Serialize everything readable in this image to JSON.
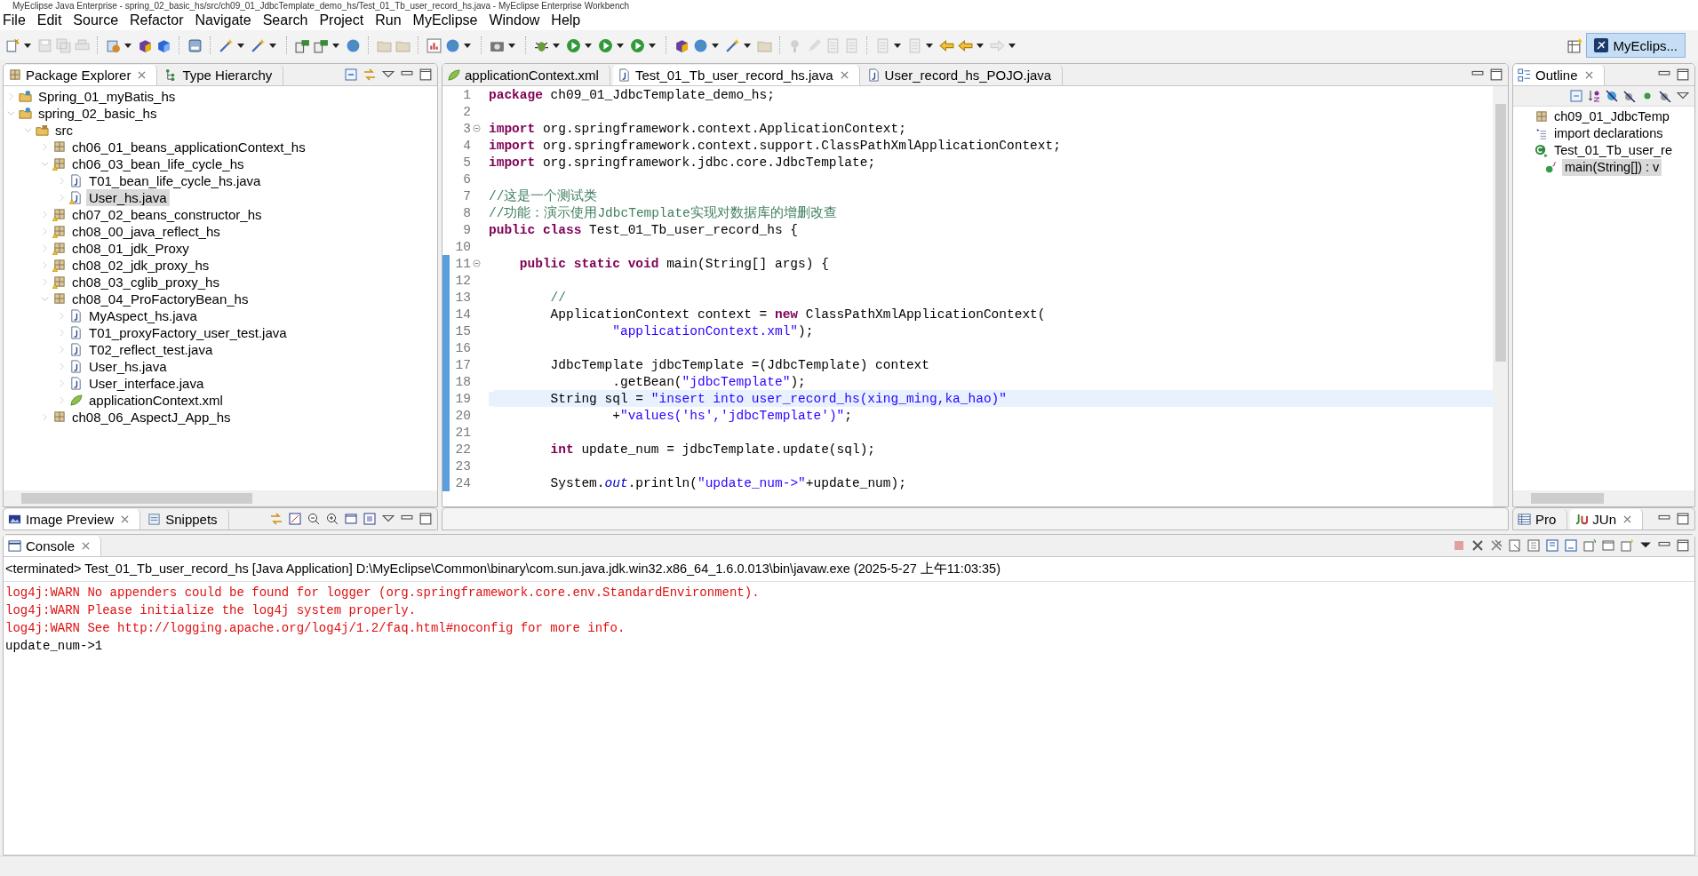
{
  "window": {
    "title": "MyEclipse Java Enterprise - spring_02_basic_hs/src/ch09_01_JdbcTemplate_demo_hs/Test_01_Tb_user_record_hs.java - MyEclipse Enterprise Workbench"
  },
  "menu": [
    "File",
    "Edit",
    "Source",
    "Refactor",
    "Navigate",
    "Search",
    "Project",
    "Run",
    "MyEclipse",
    "Window",
    "Help"
  ],
  "perspective": {
    "label": "MyEclips...",
    "selected": true
  },
  "left_tabs": [
    {
      "label": "Package Explorer",
      "selected": true,
      "kind": "package"
    },
    {
      "label": "Type Hierarchy",
      "selected": false,
      "kind": "hierarchy"
    }
  ],
  "package_explorer": {
    "items": [
      {
        "label": "Spring_01_myBatis_hs",
        "kind": "project",
        "expanded": false,
        "selected": false
      },
      {
        "label": "spring_02_basic_hs",
        "kind": "project",
        "expanded": true,
        "selected": false,
        "children": [
          {
            "label": "src",
            "kind": "folder",
            "expanded": true,
            "selected": false,
            "children": [
              {
                "label": "ch06_01_beans_applicationContext_hs",
                "kind": "package",
                "expanded": false,
                "selected": false
              },
              {
                "label": "ch06_03_bean_life_cycle_hs",
                "kind": "package-warn",
                "expanded": true,
                "selected": false,
                "children": [
                  {
                    "label": "T01_bean_life_cycle_hs.java",
                    "kind": "java",
                    "expanded": false,
                    "selected": false
                  },
                  {
                    "label": "User_hs.java",
                    "kind": "java-warn",
                    "expanded": false,
                    "selected": true
                  }
                ]
              },
              {
                "label": "ch07_02_beans_constructor_hs",
                "kind": "package-warn",
                "expanded": false,
                "selected": false
              },
              {
                "label": "ch08_00_java_reflect_hs",
                "kind": "package-warn",
                "expanded": false,
                "selected": false
              },
              {
                "label": "ch08_01_jdk_Proxy",
                "kind": "package-warn",
                "expanded": false,
                "selected": false
              },
              {
                "label": "ch08_02_jdk_proxy_hs",
                "kind": "package-warn",
                "expanded": false,
                "selected": false
              },
              {
                "label": "ch08_03_cglib_proxy_hs",
                "kind": "package-warn",
                "expanded": false,
                "selected": false
              },
              {
                "label": "ch08_04_ProFactoryBean_hs",
                "kind": "package",
                "expanded": true,
                "selected": false,
                "children": [
                  {
                    "label": "MyAspect_hs.java",
                    "kind": "java",
                    "expanded": false,
                    "selected": false
                  },
                  {
                    "label": "T01_proxyFactory_user_test.java",
                    "kind": "java",
                    "expanded": false,
                    "selected": false
                  },
                  {
                    "label": "T02_reflect_test.java",
                    "kind": "java",
                    "expanded": false,
                    "selected": false
                  },
                  {
                    "label": "User_hs.java",
                    "kind": "java",
                    "expanded": false,
                    "selected": false
                  },
                  {
                    "label": "User_interface.java",
                    "kind": "java",
                    "expanded": false,
                    "selected": false
                  },
                  {
                    "label": "applicationContext.xml",
                    "kind": "xml",
                    "expanded": false,
                    "selected": false
                  }
                ]
              },
              {
                "label": "ch08_06_AspectJ_App_hs",
                "kind": "package",
                "expanded": false,
                "selected": false
              }
            ]
          }
        ]
      }
    ]
  },
  "editor_tabs": [
    {
      "label": "applicationContext.xml",
      "selected": false,
      "kind": "xml"
    },
    {
      "label": "Test_01_Tb_user_record_hs.java",
      "selected": true,
      "kind": "java"
    },
    {
      "label": "User_record_hs_POJO.java",
      "selected": false,
      "kind": "java"
    }
  ],
  "code": [
    {
      "number": "1",
      "fold": false,
      "changed": false,
      "current": false,
      "segments": [
        {
          "kind": "keyword",
          "text": "package"
        },
        {
          "kind": "plain",
          "text": " ch09_01_JdbcTemplate_demo_hs;"
        }
      ]
    },
    {
      "number": "2",
      "fold": false,
      "changed": false,
      "current": false
    },
    {
      "number": "3",
      "fold": true,
      "changed": false,
      "current": false,
      "segments": [
        {
          "kind": "keyword",
          "text": "import"
        },
        {
          "kind": "plain",
          "text": " org.springframework.context.ApplicationContext;"
        }
      ]
    },
    {
      "number": "4",
      "fold": false,
      "changed": false,
      "current": false,
      "segments": [
        {
          "kind": "keyword",
          "text": "import"
        },
        {
          "kind": "plain",
          "text": " org.springframework.context.support.ClassPathXmlApplicationContext;"
        }
      ]
    },
    {
      "number": "5",
      "fold": false,
      "changed": false,
      "current": false,
      "segments": [
        {
          "kind": "keyword",
          "text": "import"
        },
        {
          "kind": "plain",
          "text": " org.springframework.jdbc.core.JdbcTemplate;"
        }
      ]
    },
    {
      "number": "6",
      "fold": false,
      "changed": false,
      "current": false
    },
    {
      "number": "7",
      "fold": false,
      "changed": false,
      "current": false,
      "segments": [
        {
          "kind": "comment",
          "text": "//这是一个测试类"
        }
      ]
    },
    {
      "number": "8",
      "fold": false,
      "changed": false,
      "current": false,
      "segments": [
        {
          "kind": "comment",
          "text": "//功能：演示使用JdbcTemplate实现对数据库的增删改查"
        }
      ]
    },
    {
      "number": "9",
      "fold": false,
      "changed": false,
      "current": false,
      "segments": [
        {
          "kind": "keyword",
          "text": "public class"
        },
        {
          "kind": "plain",
          "text": " Test_01_Tb_user_record_hs {"
        }
      ]
    },
    {
      "number": "10",
      "fold": false,
      "changed": false,
      "current": false
    },
    {
      "number": "11",
      "fold": true,
      "changed": true,
      "current": false,
      "segments": [
        {
          "kind": "keyword",
          "text": "    public static void"
        },
        {
          "kind": "plain",
          "text": " main(String[] args) {"
        }
      ]
    },
    {
      "number": "12",
      "fold": false,
      "changed": true,
      "current": false
    },
    {
      "number": "13",
      "fold": false,
      "changed": true,
      "current": false,
      "segments": [
        {
          "kind": "comment",
          "text": "        //"
        }
      ]
    },
    {
      "number": "14",
      "fold": false,
      "changed": true,
      "current": false,
      "segments": [
        {
          "kind": "plain",
          "text": "        ApplicationContext context = "
        },
        {
          "kind": "keyword",
          "text": "new"
        },
        {
          "kind": "plain",
          "text": " ClassPathXmlApplicationContext("
        }
      ]
    },
    {
      "number": "15",
      "fold": false,
      "changed": true,
      "current": false,
      "segments": [
        {
          "kind": "string",
          "text": "                \"applicationContext.xml\""
        },
        {
          "kind": "plain",
          "text": ");"
        }
      ]
    },
    {
      "number": "16",
      "fold": false,
      "changed": true,
      "current": false
    },
    {
      "number": "17",
      "fold": false,
      "changed": true,
      "current": false,
      "segments": [
        {
          "kind": "plain",
          "text": "        JdbcTemplate jdbcTemplate =(JdbcTemplate) context"
        }
      ]
    },
    {
      "number": "18",
      "fold": false,
      "changed": true,
      "current": false,
      "segments": [
        {
          "kind": "plain",
          "text": "                .getBean("
        },
        {
          "kind": "string",
          "text": "\"jdbcTemplate\""
        },
        {
          "kind": "plain",
          "text": ");"
        }
      ]
    },
    {
      "number": "19",
      "fold": false,
      "changed": true,
      "current": true,
      "segments": [
        {
          "kind": "plain",
          "text": "        String sql = "
        },
        {
          "kind": "string",
          "text": "\"insert into user_record_hs(xing_ming,ka_hao)\""
        }
      ]
    },
    {
      "number": "20",
      "fold": false,
      "changed": true,
      "current": false,
      "segments": [
        {
          "kind": "plain",
          "text": "                +"
        },
        {
          "kind": "string",
          "text": "\"values('hs','jdbcTemplate')\""
        },
        {
          "kind": "plain",
          "text": ";"
        }
      ]
    },
    {
      "number": "21",
      "fold": false,
      "changed": true,
      "current": false
    },
    {
      "number": "22",
      "fold": false,
      "changed": true,
      "current": false,
      "segments": [
        {
          "kind": "keyword",
          "text": "        int"
        },
        {
          "kind": "plain",
          "text": " update_num = jdbcTemplate.update(sql);"
        }
      ]
    },
    {
      "number": "23",
      "fold": false,
      "changed": true,
      "current": false
    },
    {
      "number": "24",
      "fold": false,
      "changed": true,
      "current": false,
      "segments": [
        {
          "kind": "plain",
          "text": "        System."
        },
        {
          "kind": "field",
          "text": "out"
        },
        {
          "kind": "plain",
          "text": ".println("
        },
        {
          "kind": "string",
          "text": "\"update_num->\""
        },
        {
          "kind": "plain",
          "text": "+update_num);"
        }
      ]
    }
  ],
  "outline": {
    "tab": {
      "label": "Outline",
      "selected": true
    },
    "items": [
      {
        "label": "ch09_01_JdbcTemp",
        "kind": "package",
        "selected": false
      },
      {
        "label": "import declarations",
        "kind": "imports",
        "selected": false
      },
      {
        "label": "Test_01_Tb_user_re",
        "kind": "class",
        "selected": false
      },
      {
        "label": "main(String[]) : v",
        "kind": "method",
        "selected": true
      }
    ]
  },
  "lower_left_tabs": [
    {
      "label": "Image Preview",
      "selected": true,
      "kind": "image"
    },
    {
      "label": "Snippets",
      "selected": false,
      "kind": "snippets"
    }
  ],
  "lower_right_tabs": [
    {
      "label": "Pro",
      "selected": false,
      "kind": "table"
    },
    {
      "label": "JUn",
      "selected": true,
      "kind": "junit"
    }
  ],
  "console": {
    "tab": {
      "label": "Console",
      "selected": true
    },
    "status": "<terminated> Test_01_Tb_user_record_hs [Java Application] D:\\MyEclipse\\Common\\binary\\com.sun.java.jdk.win32.x86_64_1.6.0.013\\bin\\javaw.exe (2025-5-27 上午11:03:35)",
    "lines": [
      {
        "kind": "error",
        "text": "log4j:WARN No appenders could be found for logger (org.springframework.core.env.StandardEnvironment)."
      },
      {
        "kind": "error",
        "text": "log4j:WARN Please initialize the log4j system properly."
      },
      {
        "kind": "error",
        "text": "log4j:WARN See http://logging.apache.org/log4j/1.2/faq.html#noconfig for more info."
      },
      {
        "kind": "output",
        "text": "update_num->1"
      }
    ]
  }
}
